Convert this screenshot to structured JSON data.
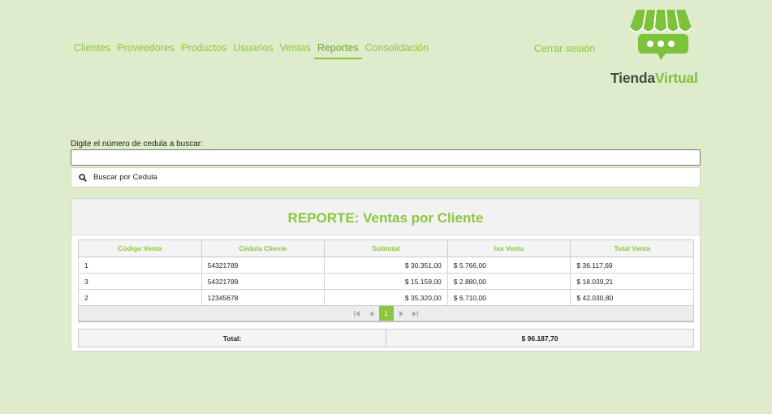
{
  "nav": {
    "items": [
      "Clientes",
      "Proveedores",
      "Productos",
      "Usuarios",
      "Ventas",
      "Reportes",
      "Consolidación"
    ],
    "active": "Reportes",
    "logout": "Cerrar sesión"
  },
  "brand": {
    "part1": "Tienda",
    "part2": "Virtual",
    "icon": "shop-awning-chat-icon"
  },
  "search": {
    "label": "Digite el número de cedula a buscar:",
    "value": "",
    "button_label": "Buscar por Cedula",
    "button_icon": "search-icon"
  },
  "report": {
    "title": "REPORTE: Ventas por Cliente",
    "columns": [
      "Código Venta",
      "Cédula Cliente",
      "Subtotal",
      "Iva Venta",
      "Total Venta"
    ],
    "rows": [
      [
        "1",
        "54321789",
        "$ 30.351,00",
        "$ 5.766,00",
        "$ 36.117,69"
      ],
      [
        "3",
        "54321789",
        "$ 15.159,00",
        "$ 2.880,00",
        "$ 18.039,21"
      ],
      [
        "2",
        "12345678",
        "$ 35.320,00",
        "$ 6.710,00",
        "$ 42.030,80"
      ]
    ],
    "pagination": {
      "current_page": "1",
      "first_icon": "first-page-icon",
      "prev_icon": "prev-page-icon",
      "next_icon": "next-page-icon",
      "last_icon": "last-page-icon"
    },
    "total_label": "Total:",
    "total_value": "$ 96.187,70"
  },
  "colors": {
    "background": "#dfeccb",
    "accent": "#8cc63f",
    "brand_dark": "#3e4a3f"
  }
}
